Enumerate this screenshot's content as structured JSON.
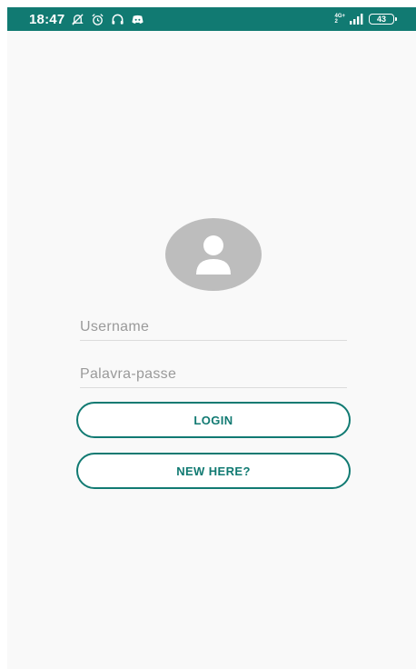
{
  "colors": {
    "status_bar": "#117a72",
    "accent": "#117a72",
    "background": "#f9f9f9",
    "avatar": "#bdbdbd"
  },
  "status_bar": {
    "time": "18:47",
    "left_icons": [
      "mute-bell-icon",
      "alarm-icon",
      "headphones-icon",
      "discord-icon"
    ],
    "network_top": "4G+",
    "network_bottom": "2",
    "battery": "43"
  },
  "login_form": {
    "avatar_icon": "person-icon",
    "username_placeholder": "Username",
    "username_value": "",
    "password_placeholder": "Palavra-passe",
    "password_value": "",
    "login_label": "LOGIN",
    "new_here_label": "NEW HERE?"
  }
}
